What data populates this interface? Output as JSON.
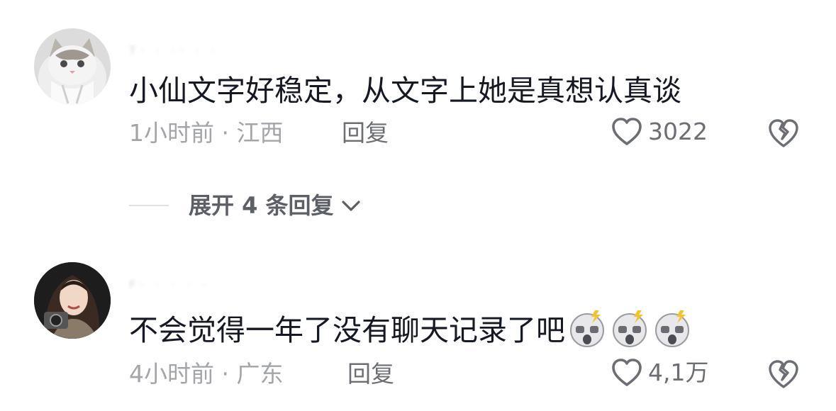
{
  "comments": [
    {
      "username": "T· · ·· · ·",
      "text": "小仙文字好稳定，从文字上她是真想认真谈",
      "time_location": "1小时前 · 江西",
      "reply_label": "回复",
      "like_count": "3022",
      "avatar_icon": "cat-avatar"
    },
    {
      "username": "F· · · · ·",
      "text": "不会觉得一年了没有聊天记录了吧",
      "time_location": "4小时前 · 广东",
      "reply_label": "回复",
      "like_count": "4,1万",
      "avatar_icon": "woman-with-camera-avatar",
      "emojis": [
        "shocked-emoji",
        "shocked-emoji",
        "shocked-emoji"
      ]
    }
  ],
  "expand_replies": {
    "label": "展开 4 条回复"
  },
  "icons": {
    "like": "heart-outline-icon",
    "dislike": "broken-heart-icon",
    "expand": "chevron-down-icon"
  },
  "colors": {
    "text": "#161823",
    "meta": "#a3a5ab",
    "action": "#6c6e74"
  }
}
